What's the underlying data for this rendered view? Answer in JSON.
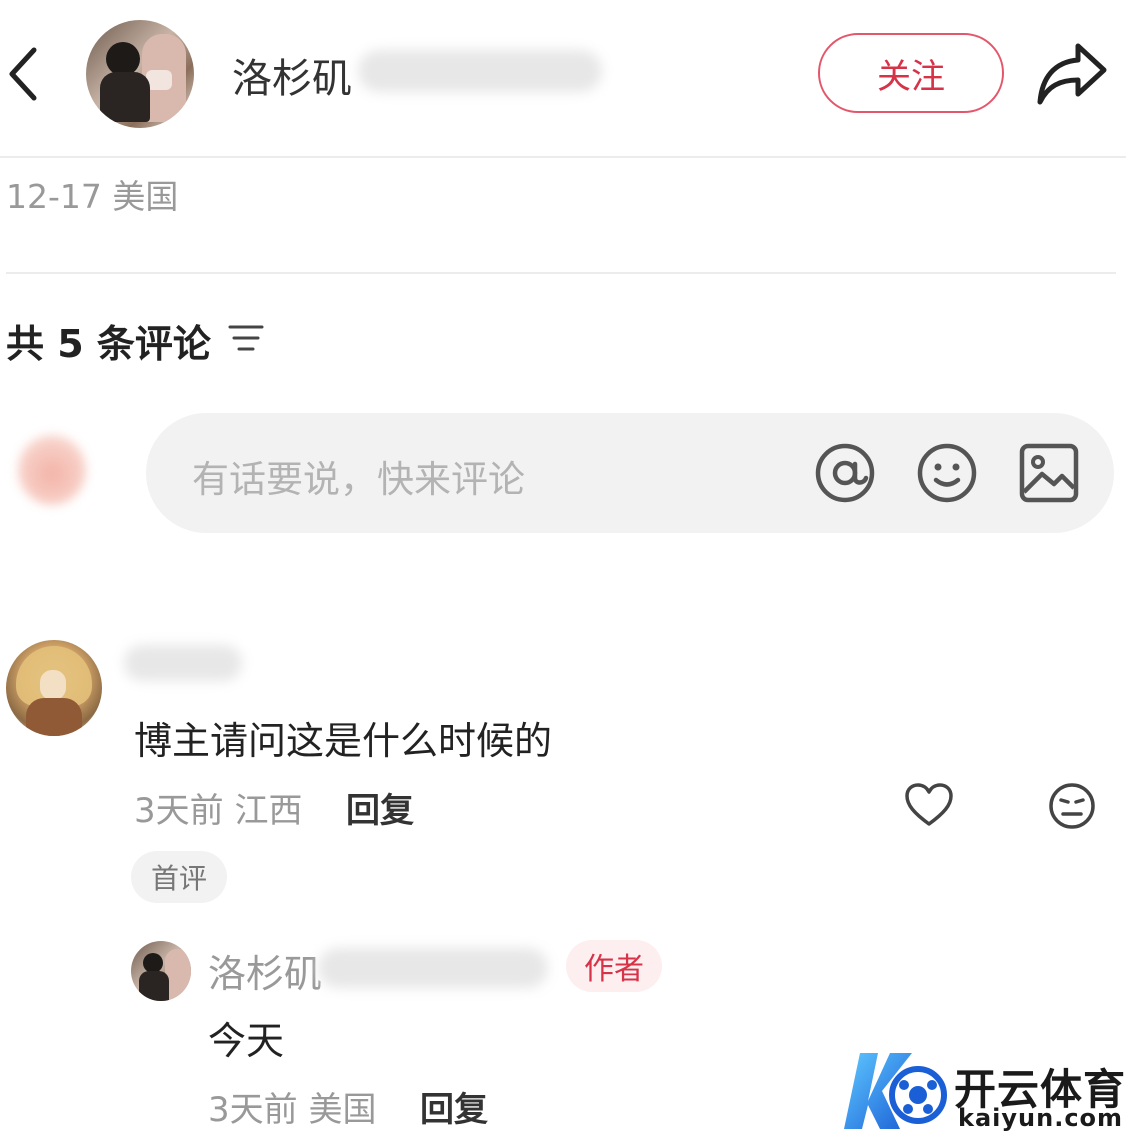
{
  "header": {
    "author_name": "洛杉矶",
    "follow_label": "关注"
  },
  "post_meta": {
    "date_location": "12-17 美国"
  },
  "comments_section": {
    "count_label": "共 5 条评论"
  },
  "comment_input": {
    "placeholder": "有话要说，快来评论"
  },
  "comments": [
    {
      "text": "博主请问这是什么时候的",
      "meta": "3天前 江西",
      "reply_label": "回复",
      "badge": "首评",
      "replies": [
        {
          "author_name": "洛杉矶",
          "author_badge": "作者",
          "text": "今天",
          "meta": "3天前 美国",
          "reply_label": "回复"
        }
      ]
    }
  ],
  "watermark": {
    "brand_cn": "开云体育",
    "brand_en": "kaiyun.com"
  },
  "colors": {
    "accent": "#d63248",
    "muted_text": "#999999",
    "input_bg": "#f2f2f2"
  },
  "icons": [
    "back-icon",
    "share-icon",
    "sort-icon",
    "at-icon",
    "emoji-icon",
    "image-icon",
    "heart-icon",
    "dislike-icon"
  ]
}
